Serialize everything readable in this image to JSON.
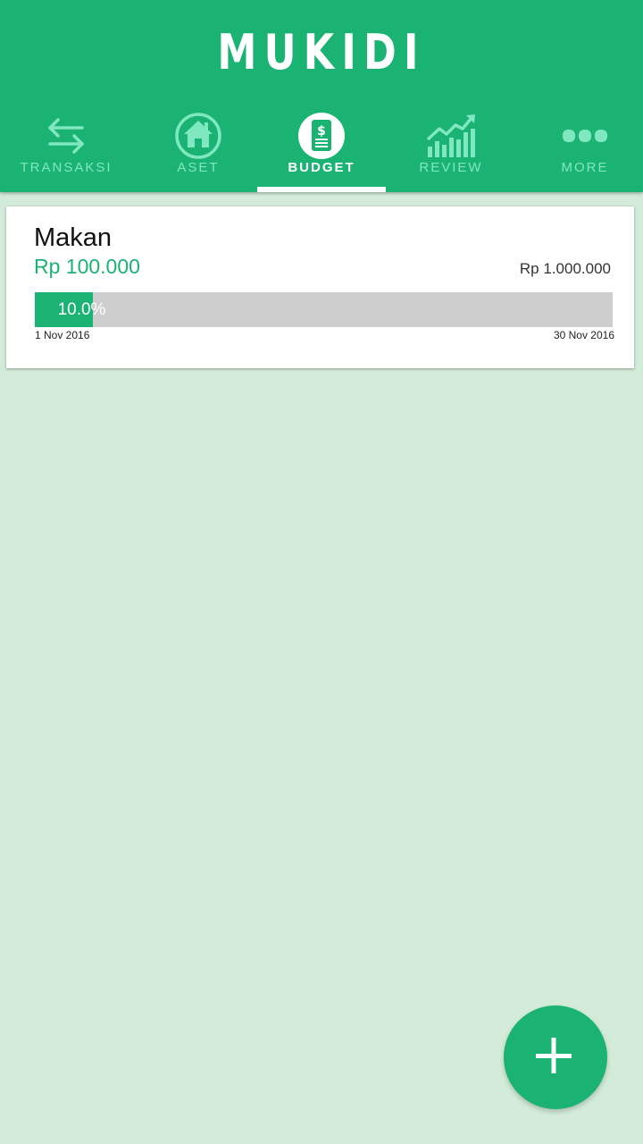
{
  "app": {
    "title": "MUKIDI"
  },
  "tabs": [
    {
      "label": "TRANSAKSI",
      "icon": "swap-arrows-icon"
    },
    {
      "label": "ASET",
      "icon": "house-icon"
    },
    {
      "label": "BUDGET",
      "icon": "budget-document-icon",
      "active": true
    },
    {
      "label": "REVIEW",
      "icon": "growth-chart-icon"
    },
    {
      "label": "MORE",
      "icon": "more-dots-icon"
    }
  ],
  "budget": {
    "name": "Makan",
    "spent": "Rp 100.000",
    "limit": "Rp 1.000.000",
    "progress_label": "10.0%",
    "progress": 0.1,
    "start_date": "1 Nov 2016",
    "end_date": "30 Nov 2016"
  },
  "colors": {
    "primary": "#1ab373",
    "background": "#d3ecd9",
    "inactive_tab": "#7fe8c0",
    "track": "#cfcece"
  },
  "fab": {
    "icon": "plus-icon"
  }
}
